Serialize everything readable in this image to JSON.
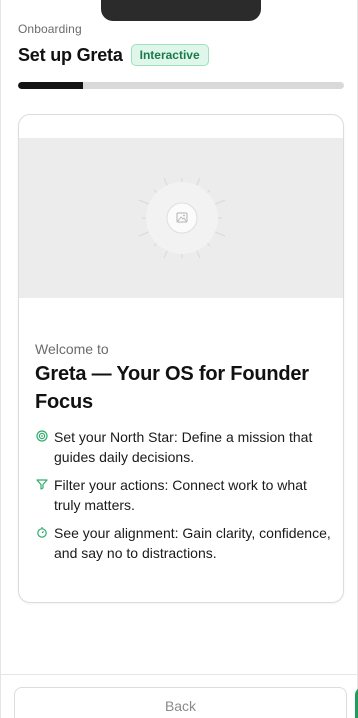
{
  "header": {
    "eyebrow": "Onboarding",
    "title": "Set up Greta",
    "badge": "Interactive"
  },
  "progress": {
    "fraction": 0.2
  },
  "card": {
    "image_icon": "image-placeholder-icon",
    "welcome": "Welcome to",
    "headline": "Greta — Your OS for Founder Focus",
    "features": [
      {
        "icon": "target-icon",
        "text": "Set your North Star: Define a mission that guides daily decisions."
      },
      {
        "icon": "filter-icon",
        "text": "Filter your actions: Connect work to what truly matters."
      },
      {
        "icon": "compass-icon",
        "text": "See your alignment: Gain clarity, confidence, and say no to distractions."
      }
    ]
  },
  "footer": {
    "back_label": "Back"
  },
  "colors": {
    "accent": "#2fae6e",
    "badge_bg": "#dff7ea",
    "badge_text": "#1b7a4c",
    "progress_fill": "#141414",
    "progress_track": "#d9d9d9"
  }
}
